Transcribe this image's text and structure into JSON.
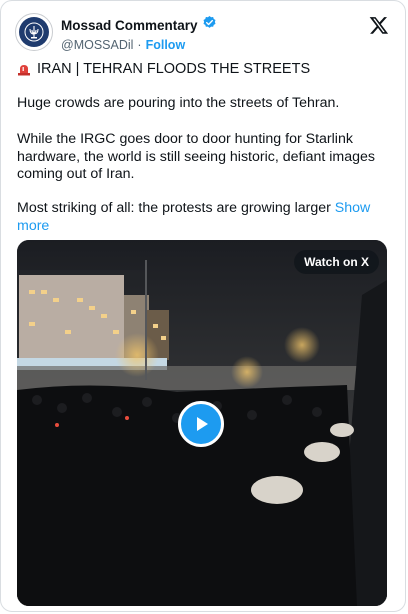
{
  "author": {
    "display_name": "Mossad Commentary",
    "handle": "@MOSSADil",
    "separator": "·",
    "follow_label": "Follow",
    "verified_color": "#1d9bf0",
    "avatar_icon": "mossad-emblem-icon"
  },
  "header": {
    "logo_icon": "x-logo-icon"
  },
  "headline": {
    "icon": "siren-icon",
    "text": "IRAN | TEHRAN FLOODS THE STREETS"
  },
  "body": {
    "p1": "Huge crowds are pouring into the streets of Tehran.",
    "p2": "While the IRGC goes door to door hunting for Starlink hardware, the world is still seeing historic, defiant images coming out of Iran.",
    "p3": "Most striking of all: the protests are growing larger",
    "show_more": "Show more"
  },
  "media": {
    "watch_label": "Watch on X",
    "play_icon": "play-icon"
  },
  "colors": {
    "accent": "#1d9bf0",
    "text": "#0f1419",
    "secondary": "#536471"
  }
}
